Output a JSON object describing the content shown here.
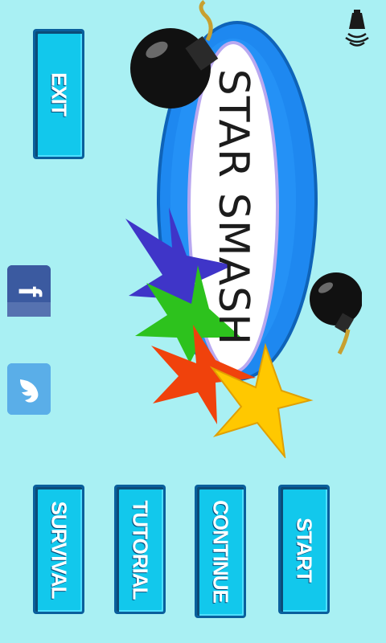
{
  "game": {
    "title": "STAR SMASH"
  },
  "menu": {
    "exit_label": "EXIT",
    "start_label": "START",
    "continue_label": "CONTINUE",
    "tutorial_label": "TUTORIAL",
    "survival_label": "SURVIVAL"
  },
  "social": {
    "facebook_glyph": "f",
    "twitter_icon": "twitter-bird-icon"
  },
  "sound": {
    "icon": "speaker-icon"
  },
  "colors": {
    "background": "#a9f0f3",
    "button": "#12c8ec",
    "ellipse_blue": "#1e88f0",
    "star_blue": "#3f35c8",
    "star_green": "#2dc21d",
    "star_red": "#f0420c",
    "star_yellow": "#ffc800"
  }
}
